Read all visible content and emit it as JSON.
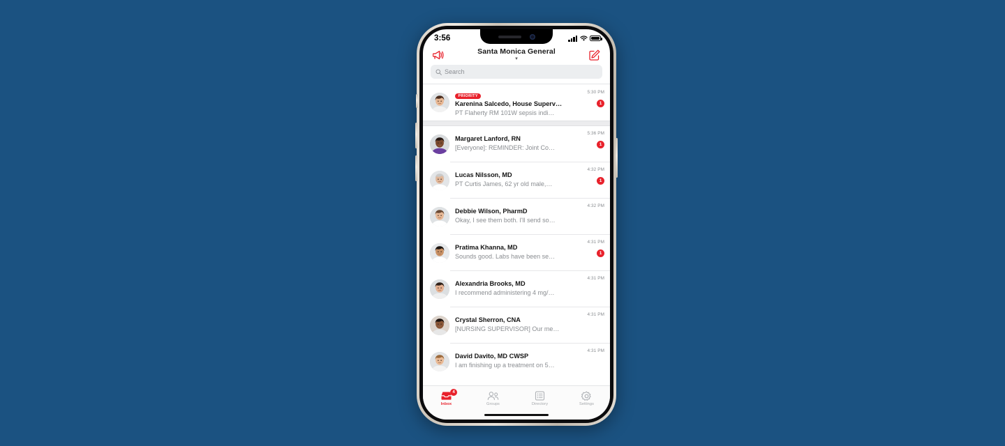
{
  "background_color": "#1b5281",
  "accent_color": "#e8212b",
  "status_bar": {
    "time": "3:56",
    "signal_icon": "cellular-signal-icon",
    "wifi_icon": "wifi-icon",
    "battery_icon": "battery-icon"
  },
  "header": {
    "announcement_icon": "megaphone-icon",
    "title": "Santa Monica General",
    "caret": "▾",
    "compose_icon": "compose-icon"
  },
  "search": {
    "icon": "search-icon",
    "placeholder": "Search",
    "value": ""
  },
  "inbox": {
    "priority_section": [
      {
        "badge": "PRIORITY",
        "name": "Karenina Salcedo, House Superv…",
        "preview": "PT Flaherty RM 101W sepsis indi…",
        "time": "5:30 PM",
        "unread": "1",
        "has_unread": true,
        "avatar": "avatar-karenina-salcedo"
      }
    ],
    "messages": [
      {
        "name": "Margaret Lanford, RN",
        "preview": "[Everyone]: REMINDER: Joint Co…",
        "time": "5:36 PM",
        "unread": "1",
        "has_unread": true,
        "avatar": "avatar-margaret-lanford"
      },
      {
        "name": "Lucas Nilsson, MD",
        "preview": "PT Curtis James, 62 yr old male,…",
        "time": "4:32 PM",
        "unread": "1",
        "has_unread": true,
        "avatar": "avatar-lucas-nilsson"
      },
      {
        "name": "Debbie Wilson, PharmD",
        "preview": "Okay, I see them both. I'll send so…",
        "time": "4:32 PM",
        "unread": "",
        "has_unread": false,
        "avatar": "avatar-debbie-wilson"
      },
      {
        "name": "Pratima Khanna, MD",
        "preview": "Sounds good. Labs have been se…",
        "time": "4:31 PM",
        "unread": "1",
        "has_unread": true,
        "avatar": "avatar-pratima-khanna"
      },
      {
        "name": "Alexandria Brooks, MD",
        "preview": "I recommend administering 4 mg/…",
        "time": "4:31 PM",
        "unread": "",
        "has_unread": false,
        "avatar": "avatar-alexandria-brooks"
      },
      {
        "name": "Crystal Sherron, CNA",
        "preview": "[NURSING SUPERVISOR] Our me…",
        "time": "4:31 PM",
        "unread": "",
        "has_unread": false,
        "avatar": "avatar-crystal-sherron"
      },
      {
        "name": "David Davito, MD CWSP",
        "preview": "I am finishing up a treatment on 5…",
        "time": "4:31 PM",
        "unread": "",
        "has_unread": false,
        "avatar": "avatar-david-davito"
      }
    ]
  },
  "tabbar": {
    "tabs": [
      {
        "label": "Inbox",
        "icon": "inbox-icon",
        "badge": "4",
        "active": true
      },
      {
        "label": "Groups",
        "icon": "groups-icon",
        "badge": "",
        "active": false
      },
      {
        "label": "Directory",
        "icon": "directory-icon",
        "badge": "",
        "active": false
      },
      {
        "label": "Settings",
        "icon": "gear-icon",
        "badge": "",
        "active": false
      }
    ]
  }
}
